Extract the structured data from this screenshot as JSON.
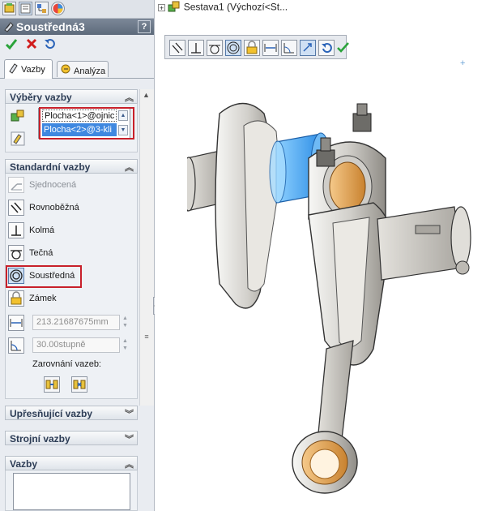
{
  "feature_tree": {
    "root_label": "Sestava1  (Výchozí<St..."
  },
  "property_manager": {
    "title": "Soustředná3",
    "help_label": "?",
    "tabs": [
      {
        "label": "Vazby"
      },
      {
        "label": "Analýza"
      }
    ],
    "sections": {
      "selections": {
        "title": "Výběry vazby",
        "items": [
          "Plocha<1>@ojnic",
          "Plocha<2>@3-kli"
        ]
      },
      "standard": {
        "title": "Standardní vazby",
        "items": [
          {
            "label": "Sjednocená",
            "icon": "coincident-icon",
            "enabled": false
          },
          {
            "label": "Rovnoběžná",
            "icon": "parallel-icon",
            "enabled": true
          },
          {
            "label": "Kolmá",
            "icon": "perpendicular-icon",
            "enabled": true
          },
          {
            "label": "Tečná",
            "icon": "tangent-icon",
            "enabled": true
          },
          {
            "label": "Soustředná",
            "icon": "concentric-icon",
            "enabled": true,
            "selected": true
          },
          {
            "label": "Zámek",
            "icon": "lock-icon",
            "enabled": true
          }
        ],
        "distance_value": "213.21687675mm",
        "angle_value": "30.00stupně",
        "alignment_label": "Zarovnání vazeb:"
      },
      "advanced": {
        "title": "Upřesňující vazby"
      },
      "mechanical": {
        "title": "Strojní vazby"
      },
      "mates": {
        "title": "Vazby"
      }
    }
  },
  "colors": {
    "highlight_red": "#c8202a",
    "selection_blue": "#3f88e0",
    "confirm_green": "#2aa33a",
    "cancel_red": "#d11d1d"
  }
}
